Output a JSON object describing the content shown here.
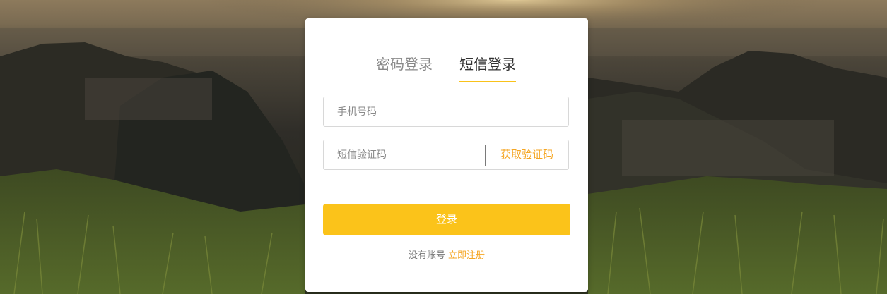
{
  "tabs": {
    "password_login": "密码登录",
    "sms_login": "短信登录",
    "active": "sms_login"
  },
  "form": {
    "phone_placeholder": "手机号码",
    "phone_value": "",
    "code_placeholder": "短信验证码",
    "code_value": "",
    "get_code_label": "获取验证码"
  },
  "login_button_label": "登录",
  "signup": {
    "prompt": "没有账号",
    "link_label": "立即注册"
  },
  "colors": {
    "accent": "#fbc31a",
    "link": "#f5a623",
    "card_background": "#ffffff"
  }
}
